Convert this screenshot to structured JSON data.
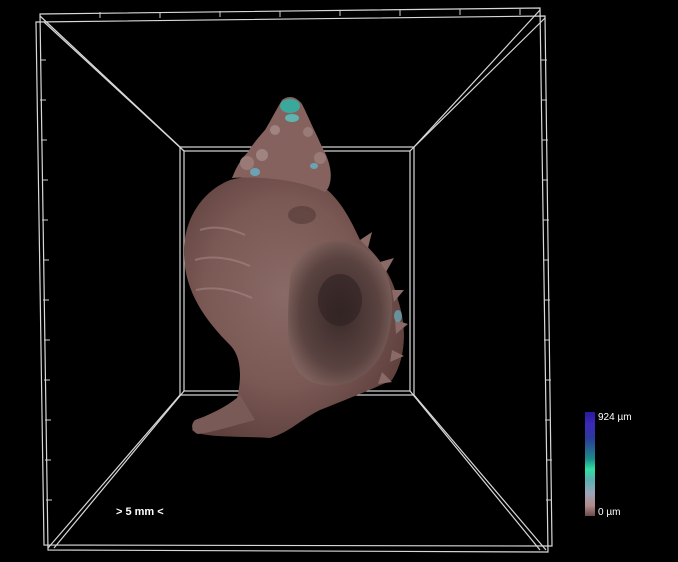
{
  "viewer": {
    "scale_bar_label": "> 5 mm <",
    "colorbar": {
      "max_label": "924 µm",
      "min_label": "0 µm",
      "max_value_um": 924,
      "min_value_um": 0,
      "colors": [
        "#2a1aa0",
        "#1e8a8a",
        "#2fe0a0",
        "#9aa6b8",
        "#6e4a4a"
      ]
    },
    "background_color": "#000000",
    "frame_color": "#d8d8d8",
    "object_color": "#8e6a66"
  }
}
